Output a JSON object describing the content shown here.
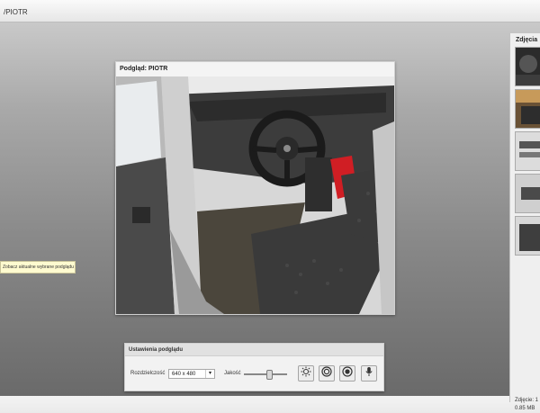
{
  "window": {
    "title": "/PIOTR"
  },
  "preview": {
    "title": "Podgląd: PIOTR"
  },
  "tooltip": {
    "text": "Zobacz aktualne wybrane podglądu"
  },
  "settings": {
    "title": "Ustawienia podglądu",
    "resolution_label": "Rozdzielczość",
    "resolution_value": "640 x 480",
    "quality_label": "Jakość",
    "quality_level": 0.58
  },
  "side_panel": {
    "title": "Zdjęcia",
    "caption_line1": "Zdjęcie: 1",
    "caption_line2": "0.85 MB"
  }
}
